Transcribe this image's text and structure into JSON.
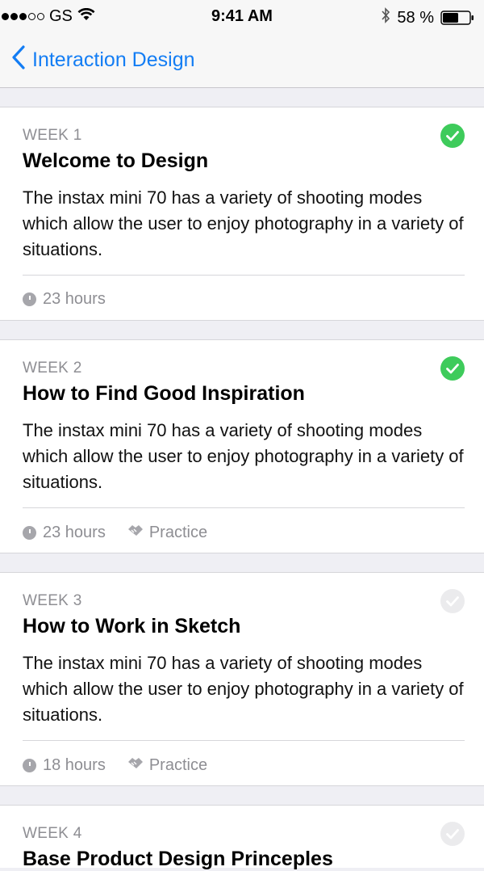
{
  "status_bar": {
    "carrier": "GS",
    "time": "9:41 AM",
    "battery": "58 %"
  },
  "nav": {
    "back_label": "Interaction Design"
  },
  "weeks": [
    {
      "week": "WEEK 1",
      "title": "Welcome to Design",
      "description": "The instax mini 70 has a variety of shooting modes which allow the user to enjoy photography in a variety of situations.",
      "duration": "23 hours",
      "completed": true
    },
    {
      "week": "WEEK 2",
      "title": "How to Find Good Inspiration",
      "description": "The instax mini 70 has a variety of shooting modes which allow the user to enjoy photography in a variety of situations.",
      "duration": "23 hours",
      "practice": "Practice",
      "completed": true
    },
    {
      "week": "WEEK 3",
      "title": "How to Work in Sketch",
      "description": "The instax mini 70 has a variety of shooting modes which allow the user to enjoy photography in a variety of situations.",
      "duration": "18 hours",
      "practice": "Practice",
      "completed": false
    },
    {
      "week": "WEEK 4",
      "title": "Base Product Design Princeples",
      "completed": false
    }
  ],
  "colors": {
    "accent": "#137df4",
    "completed": "#3ecb5b",
    "incomplete": "#ebebed",
    "muted_text": "#8e8e93",
    "background": "#efeff4"
  },
  "icons": [
    "signal-dots-icon",
    "wifi-icon",
    "bluetooth-icon",
    "battery-icon",
    "chevron-left-icon",
    "check-icon",
    "clock-icon",
    "practice-icon"
  ]
}
